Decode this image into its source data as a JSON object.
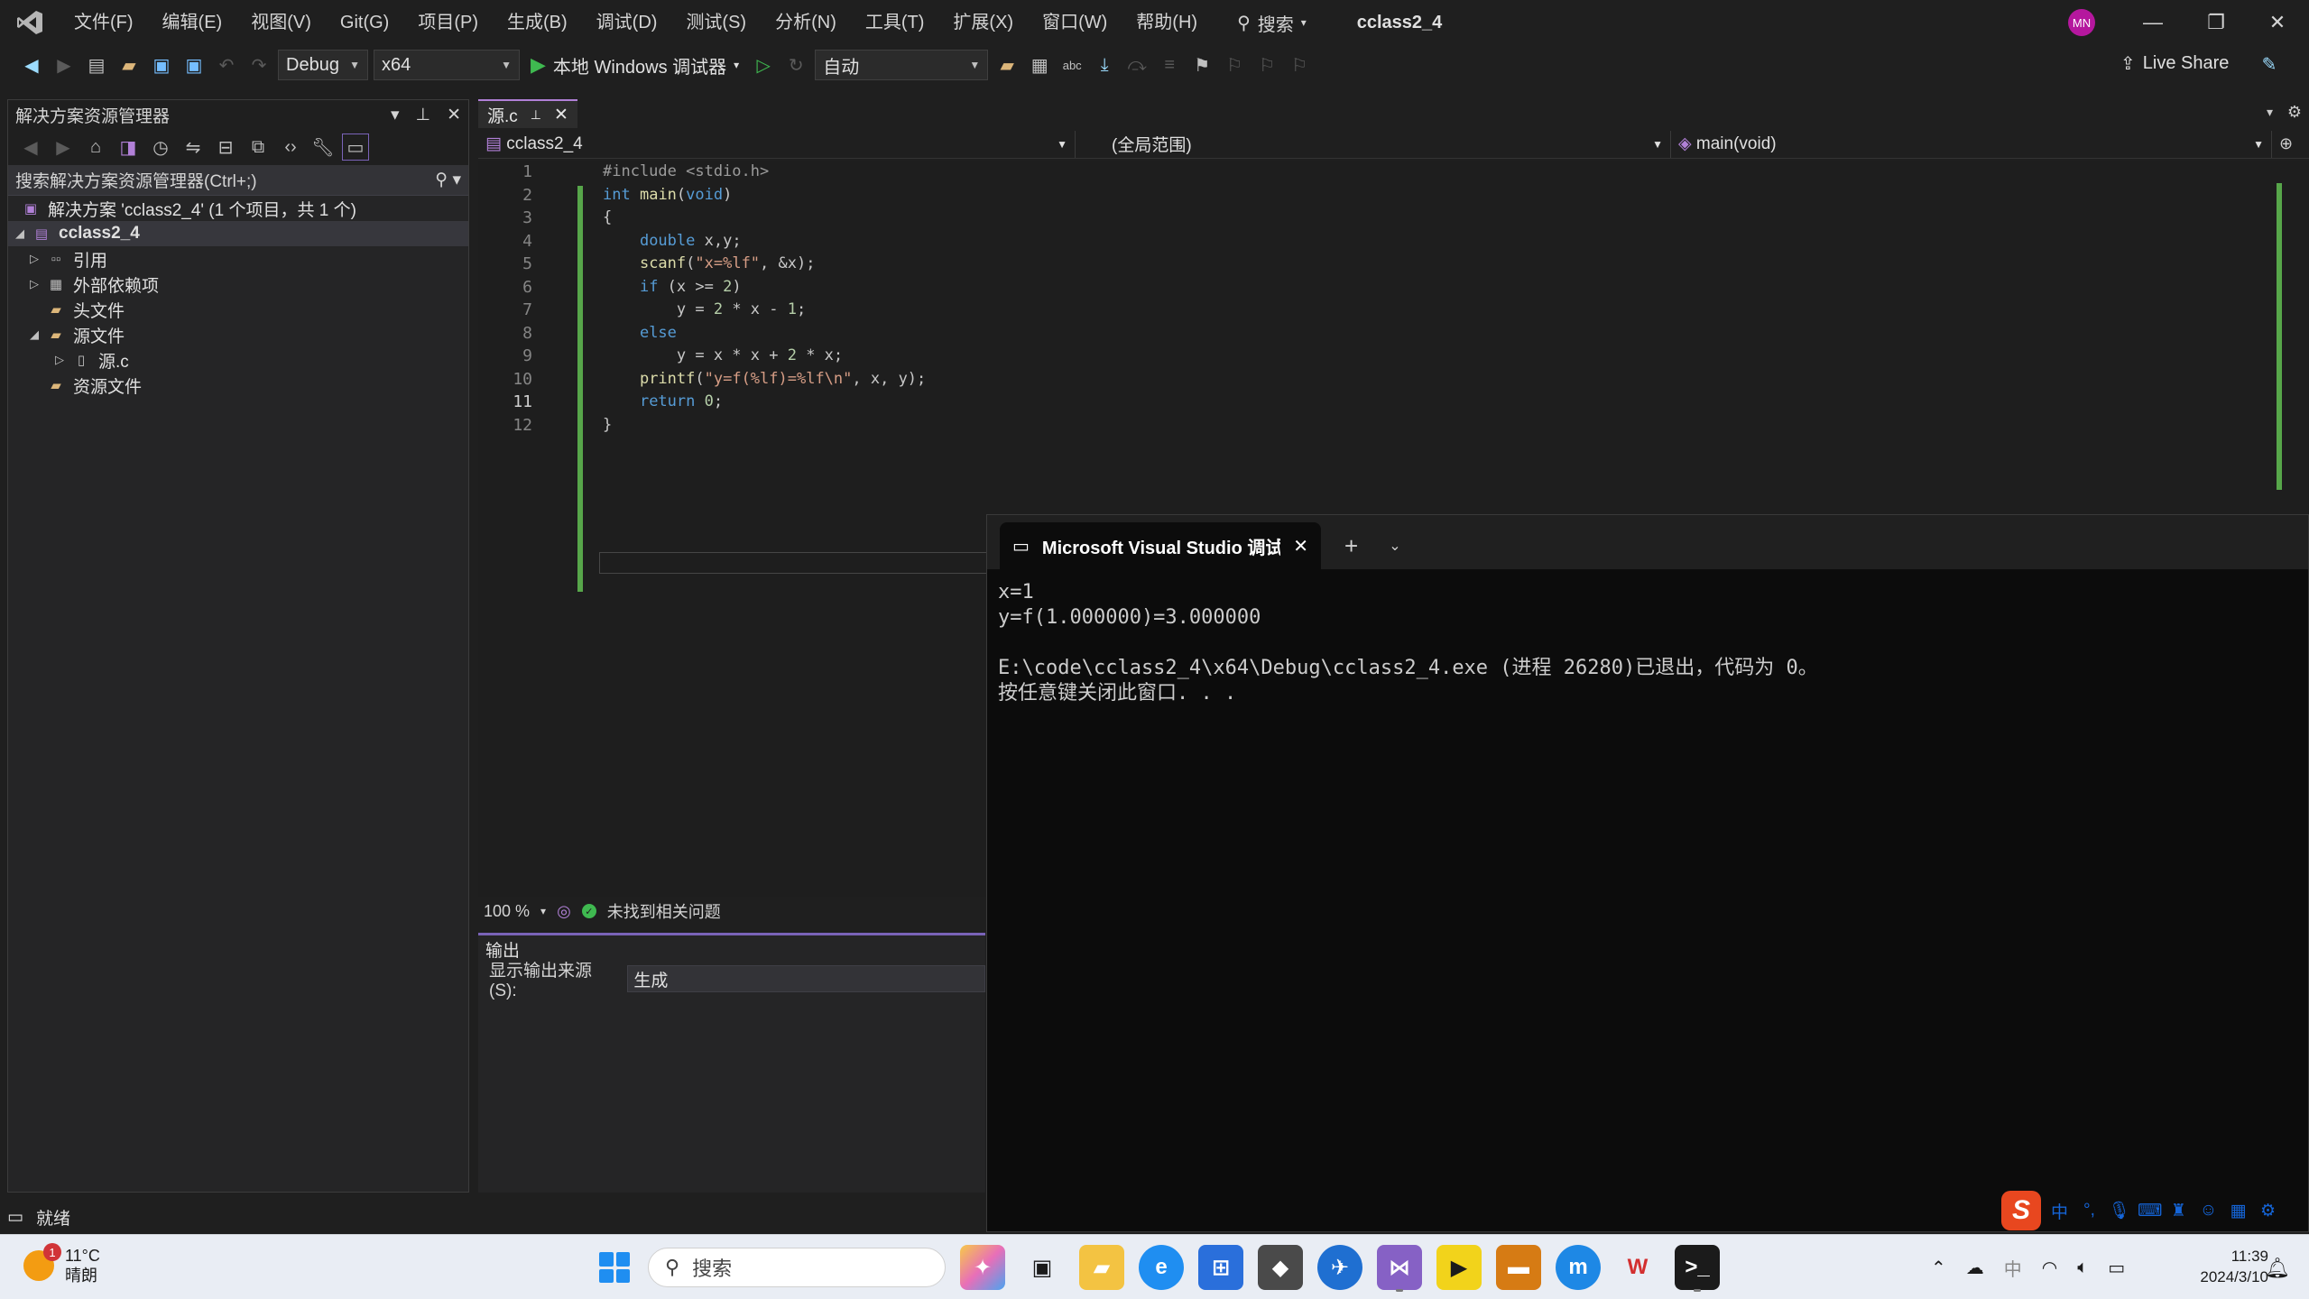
{
  "menu": {
    "items": [
      "文件(F)",
      "编辑(E)",
      "视图(V)",
      "Git(G)",
      "项目(P)",
      "生成(B)",
      "调试(D)",
      "测试(S)",
      "分析(N)",
      "工具(T)",
      "扩展(X)",
      "窗口(W)",
      "帮助(H)"
    ],
    "search_label": "搜索",
    "solution_title": "cclass2_4",
    "avatar_initials": "MN"
  },
  "toolbar": {
    "config": "Debug",
    "platform": "x64",
    "run_label": "本地 Windows 调试器",
    "auto_label": "自动",
    "live_share": "Live Share"
  },
  "solution_explorer": {
    "title": "解决方案资源管理器",
    "search_placeholder": "搜索解决方案资源管理器(Ctrl+;)",
    "solution_node": "解决方案 'cclass2_4' (1 个项目，共 1 个)",
    "project_node": "cclass2_4",
    "items": [
      "引用",
      "外部依赖项",
      "头文件",
      "源文件",
      "源.c",
      "资源文件"
    ]
  },
  "editor": {
    "tab_label": "源.c",
    "nav_project": "cclass2_4",
    "nav_scope": "(全局范围)",
    "nav_member": "main(void)",
    "line_numbers": [
      "1",
      "2",
      "3",
      "4",
      "5",
      "6",
      "7",
      "8",
      "9",
      "10",
      "11",
      "12"
    ],
    "zoom": "100 %",
    "issues": "未找到相关问题"
  },
  "output": {
    "title": "输出",
    "source_label": "显示输出来源(S):",
    "source_value": "生成"
  },
  "terminal": {
    "tab_title": "Microsoft Visual Studio 调试",
    "lines": [
      "x=1",
      "y=f(1.000000)=3.000000",
      "",
      "E:\\code\\cclass2_4\\x64\\Debug\\cclass2_4.exe (进程 26280)已退出，代码为 0。",
      "按任意键关闭此窗口. . ."
    ]
  },
  "status": {
    "text": "就绪"
  },
  "taskbar": {
    "temperature": "11°C",
    "weather": "晴朗",
    "notification_count": "1",
    "search_label": "搜索",
    "time": "11:39",
    "date": "2024/3/10",
    "ime_lang": "中"
  },
  "colors": {
    "accent": "#b180d7",
    "change_bar": "#57a64a",
    "terminal_bg": "#0c0c0c"
  }
}
